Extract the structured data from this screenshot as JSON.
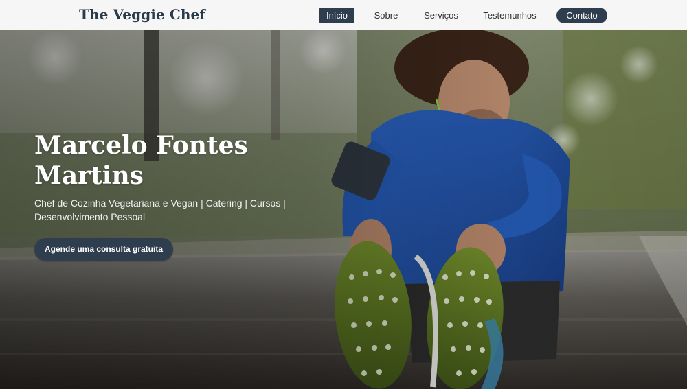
{
  "header": {
    "logo": "The Veggie Chef",
    "nav": [
      {
        "label": "Início",
        "active": true
      },
      {
        "label": "Sobre"
      },
      {
        "label": "Serviços"
      },
      {
        "label": "Testemunhos"
      },
      {
        "label": "Contato",
        "cta": true
      }
    ]
  },
  "hero": {
    "title": "Marcelo Fontes Martins",
    "subtitle": "Chef de Cozinha Vegetariana e Vegan | Catering | Cursos | Desenvolvimento Pessoal",
    "button_label": "Agende uma consulta gratuita",
    "image": "man-stretching-on-park-path",
    "colors": {
      "accent": "#2f3e4e",
      "jacket": "#1f4fa3",
      "road": "#3a3633",
      "foliage": "#5a6a3e"
    }
  }
}
